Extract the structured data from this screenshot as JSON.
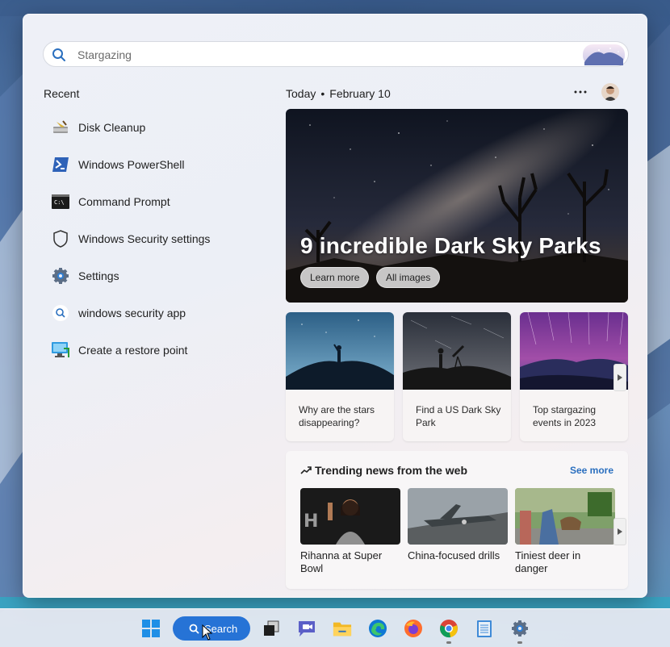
{
  "search": {
    "placeholder": "Stargazing",
    "value": ""
  },
  "recent": {
    "title": "Recent",
    "items": [
      {
        "label": "Disk Cleanup",
        "icon": "disk-cleanup-icon"
      },
      {
        "label": "Windows PowerShell",
        "icon": "powershell-icon"
      },
      {
        "label": "Command Prompt",
        "icon": "command-prompt-icon"
      },
      {
        "label": "Windows Security settings",
        "icon": "shield-icon"
      },
      {
        "label": "Settings",
        "icon": "gear-icon"
      },
      {
        "label": "windows security app",
        "icon": "search-icon"
      },
      {
        "label": "Create a restore point",
        "icon": "system-restore-icon"
      }
    ]
  },
  "today": {
    "label": "Today",
    "separator": "•",
    "date": "February 10"
  },
  "hero": {
    "title": "9 incredible Dark Sky Parks",
    "learn_more": "Learn more",
    "all_images": "All images"
  },
  "cards": [
    {
      "text": "Why are the stars disappearing?"
    },
    {
      "text": "Find a US Dark Sky Park"
    },
    {
      "text": "Top stargazing events in 2023"
    }
  ],
  "trending": {
    "title": "Trending news from the web",
    "see_more": "See more",
    "items": [
      {
        "text": "Rihanna at Super Bowl"
      },
      {
        "text": "China-focused drills"
      },
      {
        "text": "Tiniest deer in danger"
      }
    ]
  },
  "taskbar": {
    "search_label": "Search",
    "apps": [
      "start-icon",
      "task-view-icon",
      "teams-chat-icon",
      "file-explorer-icon",
      "edge-icon",
      "firefox-icon",
      "chrome-icon",
      "notepad-icon",
      "settings-gear-icon"
    ]
  },
  "colors": {
    "accent": "#2673d6",
    "link": "#2a6fbf"
  }
}
